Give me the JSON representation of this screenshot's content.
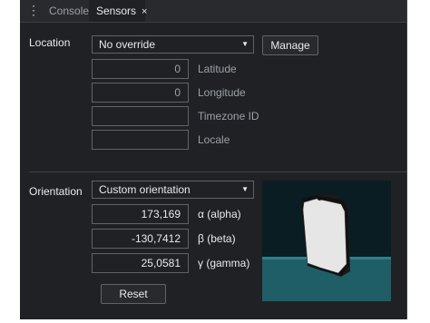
{
  "tabs": [
    {
      "label": "Console"
    },
    {
      "label": "Sensors",
      "close": "×"
    }
  ],
  "location": {
    "label": "Location",
    "select_value": "No override",
    "manage_label": "Manage",
    "fields": [
      {
        "value": "0",
        "label": "Latitude"
      },
      {
        "value": "0",
        "label": "Longitude"
      },
      {
        "value": "",
        "label": "Timezone ID"
      },
      {
        "value": "",
        "label": "Locale"
      }
    ]
  },
  "orientation": {
    "label": "Orientation",
    "select_value": "Custom orientation",
    "fields": [
      {
        "value": "173,169",
        "label": "α (alpha)"
      },
      {
        "value": "-130,7412",
        "label": "β (beta)"
      },
      {
        "value": "25,0581",
        "label": "γ (gamma)"
      }
    ],
    "reset_label": "Reset"
  },
  "icons": {
    "menu": "more-vertical-icon",
    "close": "close-icon",
    "dropdown": "chevron-down-icon"
  },
  "colors": {
    "panel_bg": "#202124",
    "tabbar_bg": "#292a2d",
    "border": "#5f6368",
    "preview_bg": "#0a1d22",
    "preview_floor": "#1f5e66"
  }
}
